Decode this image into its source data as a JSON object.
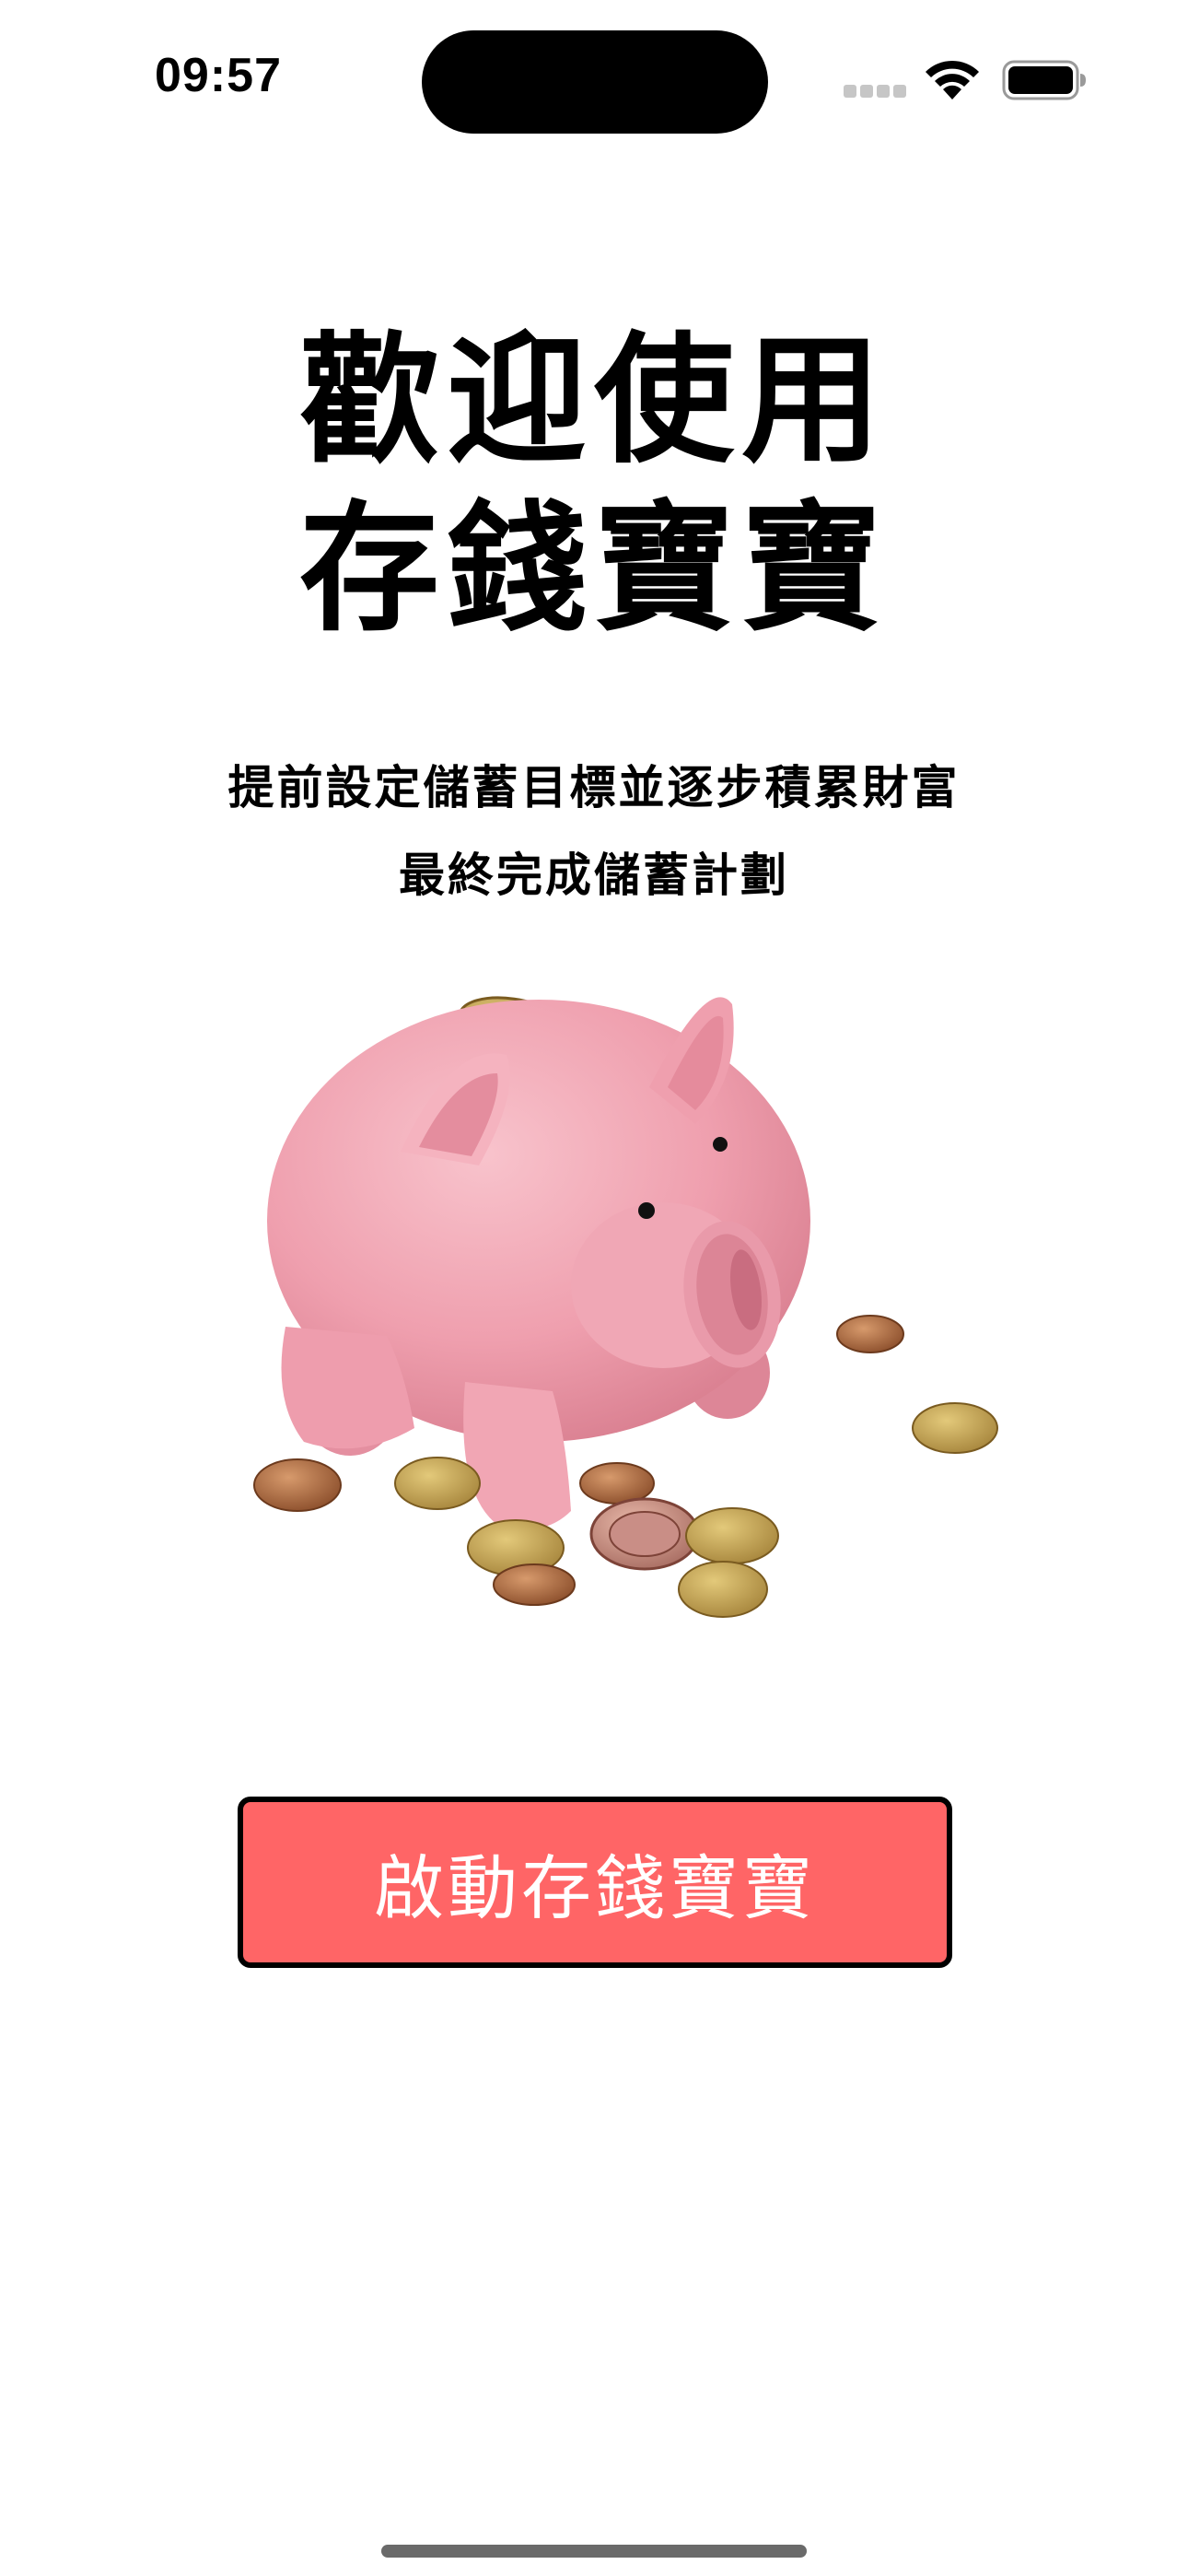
{
  "status_bar": {
    "time": "09:57",
    "icons": [
      "signal-icon",
      "wifi-icon",
      "battery-icon"
    ]
  },
  "welcome": {
    "title_line1": "歡迎使用",
    "title_line2": "存錢寶寶",
    "description_line1": "提前設定儲蓄目標並逐步積累財富",
    "description_line2": "最終完成儲蓄計劃"
  },
  "illustration": {
    "subject": "piggy-bank-with-coins"
  },
  "start_button": {
    "label": "啟動存錢寶寶",
    "color": "#ff6566"
  }
}
